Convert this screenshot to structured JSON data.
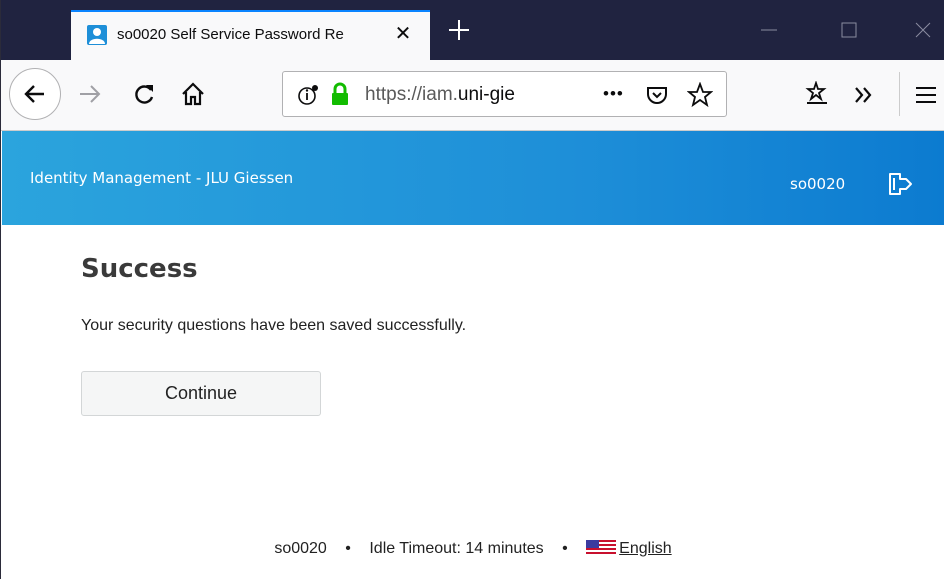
{
  "browser": {
    "tab_title": "so0020 Self Service Password Re",
    "url_prefix": "https://iam.",
    "url_domain": "uni-gie",
    "page_action_dots": "•••"
  },
  "header": {
    "title": "Identity Management - JLU Giessen",
    "username": "so0020"
  },
  "main": {
    "title": "Success",
    "message": "Your security questions have been saved successfully.",
    "continue_label": "Continue"
  },
  "footer": {
    "username": "so0020",
    "separator": "•",
    "idle_timeout": "Idle Timeout: 14 minutes",
    "language": "English"
  },
  "colors": {
    "header_gradient_start": "#2ba4dd",
    "header_gradient_end": "#0c7bd0",
    "tabstrip": "#202340",
    "tab_accent": "#0a84ff",
    "lock_green": "#12bc00"
  }
}
